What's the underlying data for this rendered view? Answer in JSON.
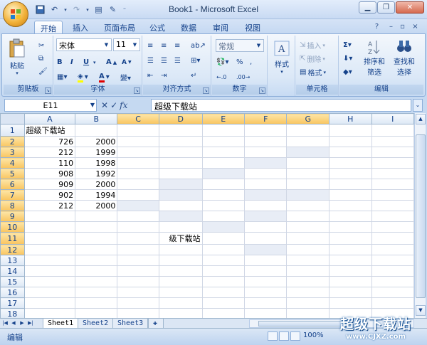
{
  "window": {
    "title": "Book1 - Microsoft Excel"
  },
  "tabs": [
    "开始",
    "插入",
    "页面布局",
    "公式",
    "数据",
    "审阅",
    "视图"
  ],
  "ribbon": {
    "clipboard": {
      "label": "剪贴板",
      "paste": "粘贴"
    },
    "font": {
      "label": "字体",
      "name": "宋体",
      "size": "11",
      "bold": "B",
      "italic": "I",
      "underline": "U"
    },
    "alignment": {
      "label": "对齐方式"
    },
    "number": {
      "label": "数字",
      "format": "常规"
    },
    "styles": {
      "label": "样式"
    },
    "cells": {
      "label": "单元格",
      "insert": "插入",
      "delete": "删除",
      "format": "格式"
    },
    "editing": {
      "label": "编辑",
      "sort": "排序和",
      "sort2": "筛选",
      "find": "查找和",
      "find2": "选择"
    }
  },
  "formula_bar": {
    "name_box": "E11",
    "content": "超级下载站"
  },
  "columns": [
    "A",
    "B",
    "C",
    "D",
    "E",
    "F",
    "G",
    "H",
    "I"
  ],
  "rows": [
    {
      "n": "1",
      "a": "超级下载站",
      "b": ""
    },
    {
      "n": "2",
      "a": "726",
      "b": "2000"
    },
    {
      "n": "3",
      "a": "212",
      "b": "1999"
    },
    {
      "n": "4",
      "a": "110",
      "b": "1998"
    },
    {
      "n": "5",
      "a": "908",
      "b": "1992"
    },
    {
      "n": "6",
      "a": "909",
      "b": "2000"
    },
    {
      "n": "7",
      "a": "902",
      "b": "1994"
    },
    {
      "n": "8",
      "a": "212",
      "b": "2000"
    },
    {
      "n": "9",
      "a": "",
      "b": ""
    },
    {
      "n": "10",
      "a": "",
      "b": ""
    },
    {
      "n": "11",
      "a": "",
      "b": ""
    },
    {
      "n": "12",
      "a": "",
      "b": ""
    },
    {
      "n": "13",
      "a": "",
      "b": ""
    },
    {
      "n": "14",
      "a": "",
      "b": ""
    },
    {
      "n": "15",
      "a": "",
      "b": ""
    },
    {
      "n": "16",
      "a": "",
      "b": ""
    },
    {
      "n": "17",
      "a": "",
      "b": ""
    },
    {
      "n": "18",
      "a": "",
      "b": ""
    }
  ],
  "e11_overflow": "级下载站",
  "sheets": [
    "Sheet1",
    "Sheet2",
    "Sheet3"
  ],
  "status": {
    "mode": "编辑",
    "zoom": "100%"
  },
  "watermark": {
    "big": "超级下载站",
    "small": "www.CJXZ.com"
  },
  "colors": {
    "selected_header": "#f9c55f",
    "ribbon_blue": "#c5d9f1"
  }
}
